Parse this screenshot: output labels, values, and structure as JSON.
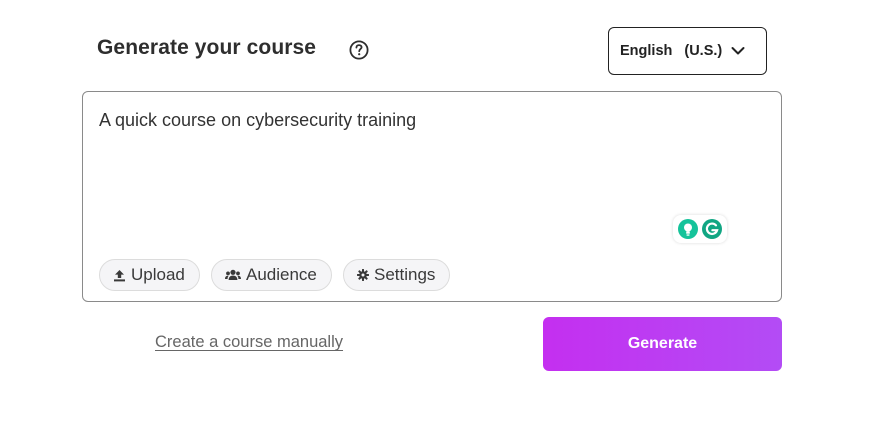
{
  "header": {
    "title": "Generate your course",
    "help_icon": "question-circle-icon"
  },
  "language": {
    "name": "English",
    "region": "(U.S.)",
    "icon": "chevron-down-icon"
  },
  "prompt": {
    "value": "A quick course on cybersecurity training"
  },
  "assistant": {
    "icons": [
      "grammarly-suggestion-icon",
      "grammarly-icon"
    ],
    "colors": {
      "bulb": "#15c39a",
      "logo": "#11a683"
    }
  },
  "chips": {
    "upload": {
      "label": "Upload",
      "icon": "upload-icon"
    },
    "audience": {
      "label": "Audience",
      "icon": "users-icon"
    },
    "settings": {
      "label": "Settings",
      "icon": "gear-icon"
    }
  },
  "actions": {
    "manual_link": "Create a course manually",
    "generate_label": "Generate",
    "generate_gradient": [
      "#c42ff0",
      "#b34cf5"
    ]
  }
}
